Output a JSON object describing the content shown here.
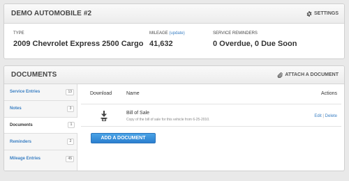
{
  "vehicle": {
    "title": "DEMO AUTOMOBILE #2",
    "settings_label": "SETTINGS",
    "type_label": "TYPE",
    "type_value": "2009 Chevrolet Express 2500 Cargo",
    "mileage_label": "MILEAGE",
    "mileage_update_link": "(update)",
    "mileage_value": "41,632",
    "service_label": "SERVICE REMINDERS",
    "service_value": "0 Overdue, 0 Due Soon"
  },
  "documents": {
    "title": "DOCUMENTS",
    "attach_label": "ATTACH A DOCUMENT",
    "sidebar": {
      "items": [
        {
          "label": "Service Entries",
          "count": "13"
        },
        {
          "label": "Notes",
          "count": "3"
        },
        {
          "label": "Documents",
          "count": "1"
        },
        {
          "label": "Reminders",
          "count": "2"
        },
        {
          "label": "Mileage Entries",
          "count": "45"
        }
      ]
    },
    "table": {
      "headers": {
        "download": "Download",
        "name": "Name",
        "actions": "Actions"
      },
      "rows": [
        {
          "name": "Bill of Sale",
          "description": "Copy of the bill of sale for this vehicle from 6-25-2010.",
          "edit": "Edit",
          "separator": "|",
          "delete": "Delete"
        }
      ]
    },
    "add_button": "ADD A DOCUMENT"
  },
  "icons": {
    "settings": "gear-icon",
    "attach": "paperclip-icon",
    "download": "download-icon"
  },
  "colors": {
    "link": "#3a7fc3",
    "button": "#2b7fcf",
    "background": "#e9e9e9"
  }
}
